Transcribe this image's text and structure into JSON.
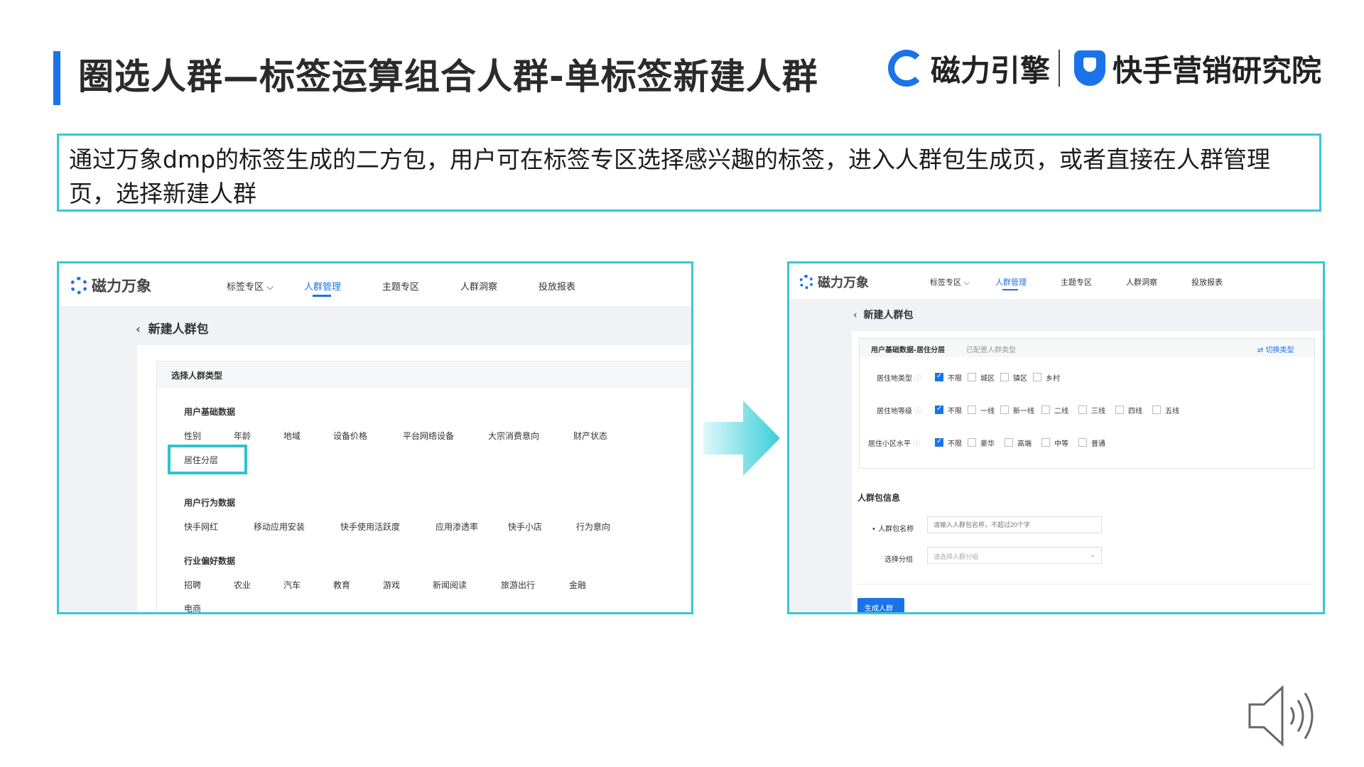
{
  "header": {
    "title": "圈选人群—标签运算组合人群-单标签新建人群",
    "logo_cili": "磁力引擎",
    "logo_ks": "快手营销研究院",
    "accent": "#1a73e8"
  },
  "description": "通过万象dmp的标签生成的二方包，用户可在标签专区选择感兴趣的标签，进入人群包生成页，或者直接在人群管理页，选择新建人群",
  "left_shot": {
    "logo": "磁力万象",
    "nav": [
      "标签专区 ⌵",
      "人群管理",
      "主题专区",
      "人群洞察",
      "投放报表"
    ],
    "back_label": "新建人群包",
    "section_title": "选择人群类型",
    "groups": [
      {
        "title": "用户基础数据",
        "items": [
          "性别",
          "年龄",
          "地域",
          "设备价格",
          "平台网络设备",
          "大宗消费意向",
          "财产状态",
          "居住分层"
        ]
      },
      {
        "title": "用户行为数据",
        "items": [
          "快手网红",
          "移动应用安装",
          "快手使用活跃度",
          "应用渗透率",
          "快手小店",
          "行为意向"
        ]
      },
      {
        "title": "行业偏好数据",
        "items": [
          "招聘",
          "农业",
          "汽车",
          "教育",
          "游戏",
          "新闻阅读",
          "旅游出行",
          "金融",
          "电商"
        ]
      }
    ],
    "highlight_color": "#2ec4c9"
  },
  "right_shot": {
    "logo": "磁力万象",
    "nav": [
      "标签专区 ⌵",
      "人群管理",
      "主题专区",
      "人群洞察",
      "投放报表"
    ],
    "back_label": "新建人群包",
    "card_title": "用户基础数据-居住分层",
    "card_sub": "已配置人群类型",
    "switch_label": "⇄ 切换类型",
    "rows": [
      {
        "label": "居住地类型",
        "options": [
          "不限",
          "城区",
          "镇区",
          "乡村"
        ]
      },
      {
        "label": "居住地等级",
        "options": [
          "不限",
          "一线",
          "新一线",
          "二线",
          "三线",
          "四线",
          "五线"
        ]
      },
      {
        "label": "居住小区水平",
        "options": [
          "不限",
          "豪华",
          "高端",
          "中等",
          "普通"
        ]
      }
    ],
    "info_title": "人群包信息",
    "name_label": "• 人群包名称",
    "name_placeholder": "请输入人群包名称，不超过20个字",
    "group_label": "选择分组",
    "group_placeholder": "请选择人群分组",
    "submit": "生成人群"
  }
}
